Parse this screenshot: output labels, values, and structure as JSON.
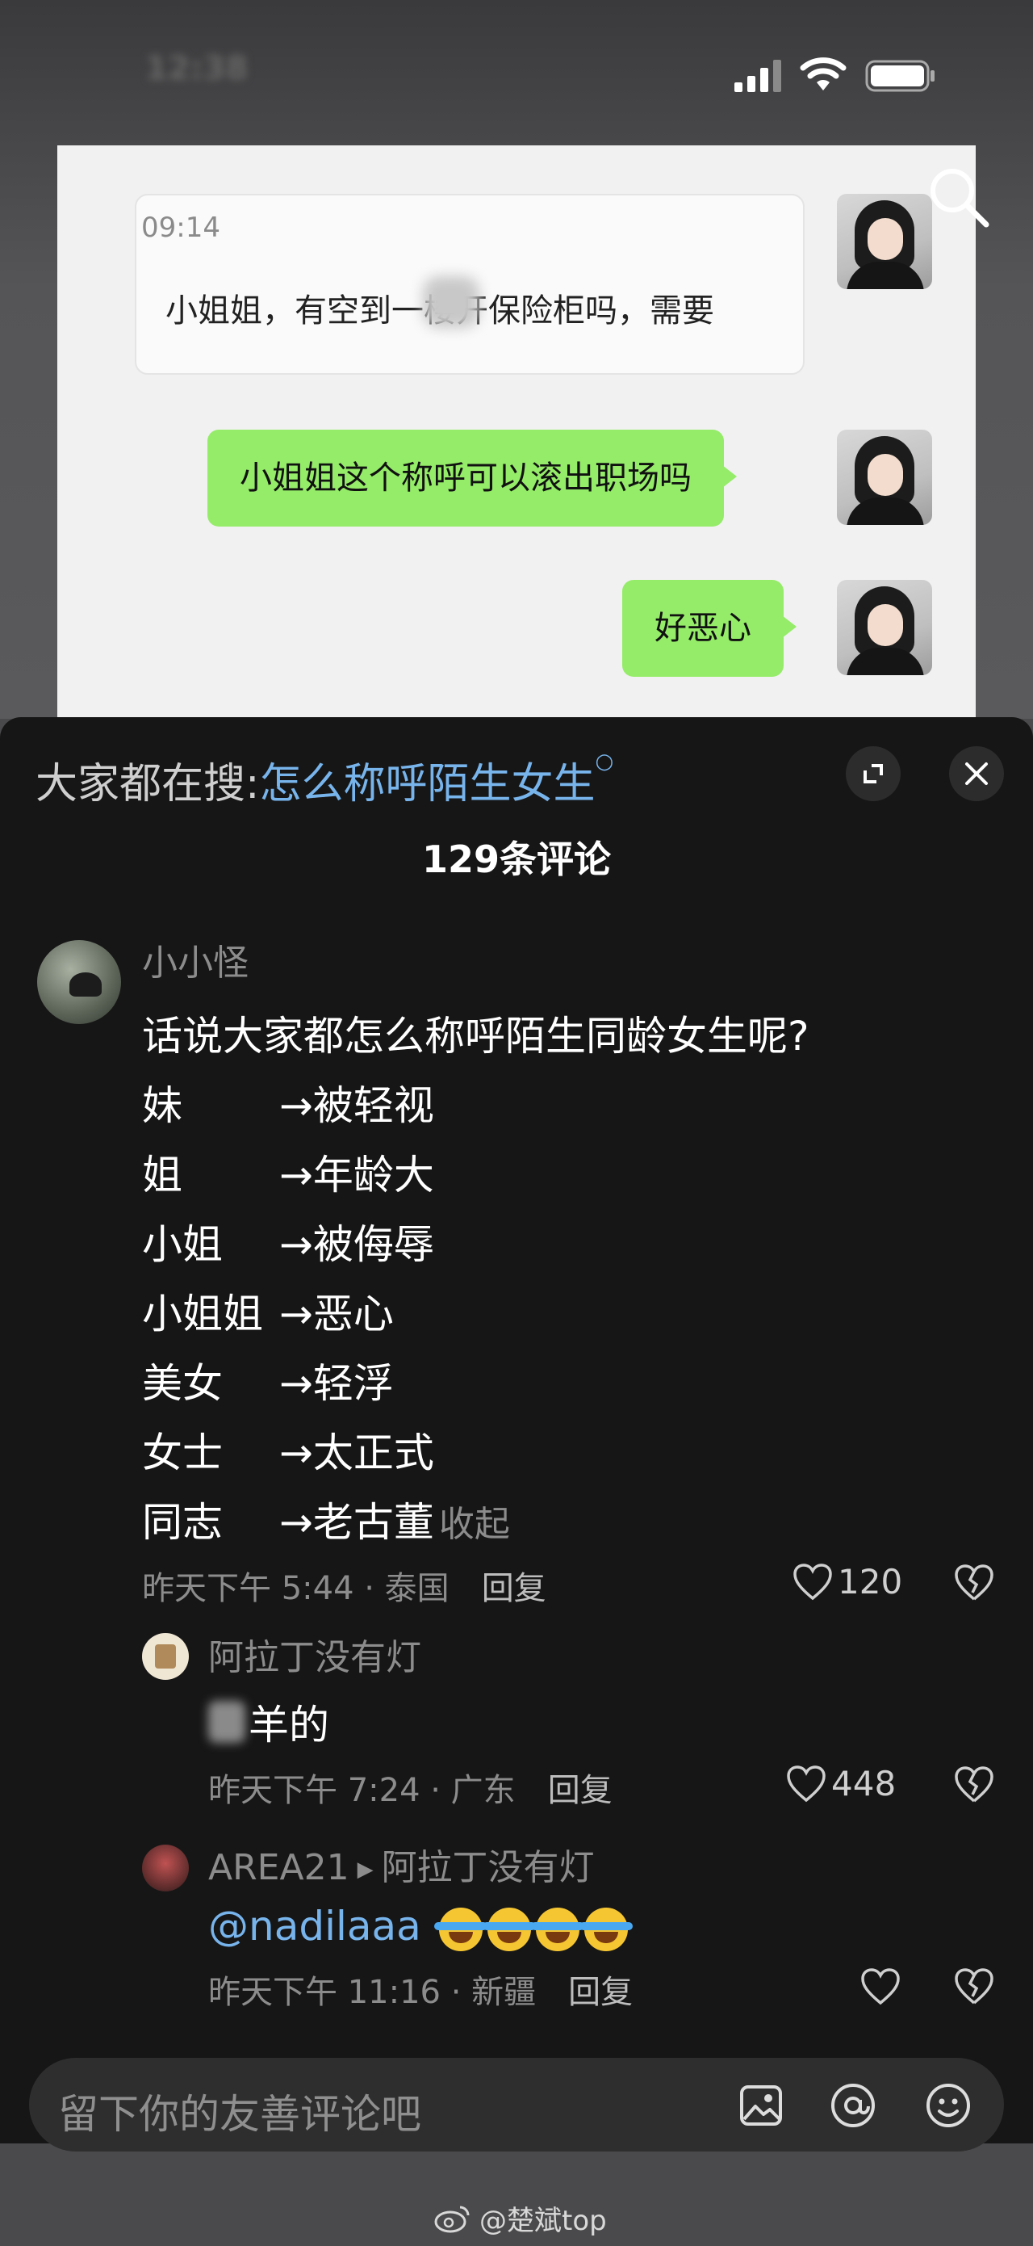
{
  "status_bar": {
    "time": "12:38"
  },
  "screenshot": {
    "quote_time": "09:14",
    "quote_text": "小姐姐，有空到一楼开保险柜吗，需要",
    "bubble1": "小姐姐这个称呼可以滚出职场吗",
    "bubble2": "好恶心"
  },
  "panel": {
    "hot_search_prefix": "大家都在搜:",
    "hot_search_keyword": "怎么称呼陌生女生",
    "comment_count": "129条评论"
  },
  "comment": {
    "user": "小小怪",
    "question": "话说大家都怎么称呼陌生同龄女生呢?",
    "terms": [
      {
        "term": "妹",
        "result": "→被轻视"
      },
      {
        "term": "姐",
        "result": "→年龄大"
      },
      {
        "term": "小姐",
        "result": "→被侮辱"
      },
      {
        "term": "小姐姐",
        "result": "→恶心"
      },
      {
        "term": "美女",
        "result": "→轻浮"
      },
      {
        "term": "女士",
        "result": "→太正式"
      },
      {
        "term": "同志",
        "result": "→老古董"
      }
    ],
    "collapse": "收起",
    "meta": "昨天下午 5:44 · 泰国",
    "reply": "回复",
    "likes": "120"
  },
  "reply1": {
    "user": "阿拉丁没有灯",
    "text": "羊的",
    "meta": "昨天下午 7:24 · 广东",
    "reply": "回复",
    "likes": "448"
  },
  "reply2": {
    "user": "AREA21",
    "reply_to": "阿拉丁没有灯",
    "text": "@nadilaaa",
    "meta": "昨天下午 11:16 · 新疆",
    "reply": "回复"
  },
  "input": {
    "placeholder": "留下你的友善评论吧"
  },
  "watermark": "@楚斌top",
  "icons": [
    "signal-icon",
    "wifi-icon",
    "battery-icon",
    "search-icon",
    "expand-icon",
    "close-icon",
    "heart-icon",
    "broken-heart-icon",
    "image-icon",
    "at-icon",
    "emoji-icon",
    "weibo-icon"
  ]
}
